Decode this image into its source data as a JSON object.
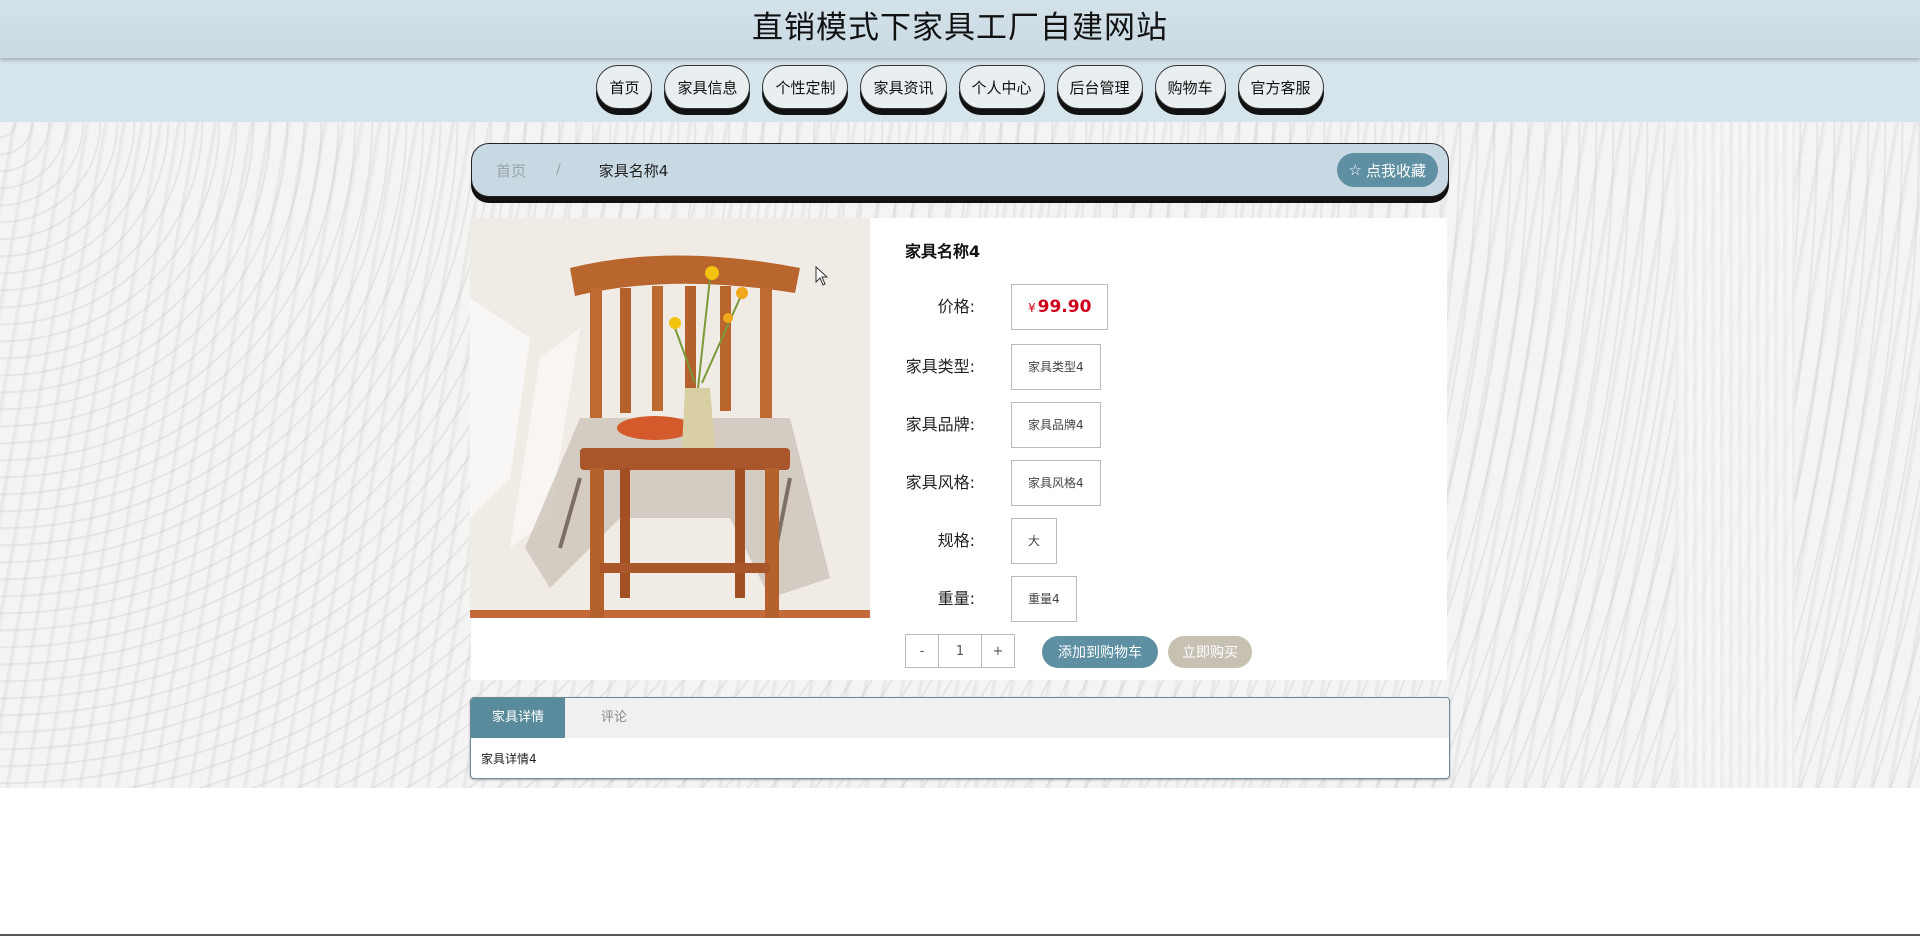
{
  "header": {
    "title": "直销模式下家具工厂自建网站"
  },
  "nav": {
    "items": [
      "首页",
      "家具信息",
      "个性定制",
      "家具资讯",
      "个人中心",
      "后台管理",
      "购物车",
      "官方客服"
    ]
  },
  "breadcrumb": {
    "home": "首页",
    "separator": "/",
    "current": "家具名称4",
    "favorite_label": "点我收藏",
    "favorite_icon": "star-outline-icon"
  },
  "product": {
    "name": "家具名称4",
    "image_alt": "wooden chair with flowers",
    "price_label": "价格:",
    "price_currency": "¥",
    "price_value": "99.90",
    "type_label": "家具类型:",
    "type_value": "家具类型4",
    "brand_label": "家具品牌:",
    "brand_value": "家具品牌4",
    "style_label": "家具风格:",
    "style_value": "家具风格4",
    "spec_label": "规格:",
    "spec_value": "大",
    "weight_label": "重量:",
    "weight_value": "重量4"
  },
  "quantity": {
    "minus": "-",
    "value": "1",
    "plus": "+"
  },
  "actions": {
    "add_to_cart": "添加到购物车",
    "buy_now": "立即购买"
  },
  "tabs": {
    "items": [
      "家具详情",
      "评论"
    ],
    "active": 0,
    "content": "家具详情4"
  },
  "colors": {
    "accent": "#5f8fa3",
    "price": "#d0021b",
    "nav_bg": "#d6e4ec"
  }
}
